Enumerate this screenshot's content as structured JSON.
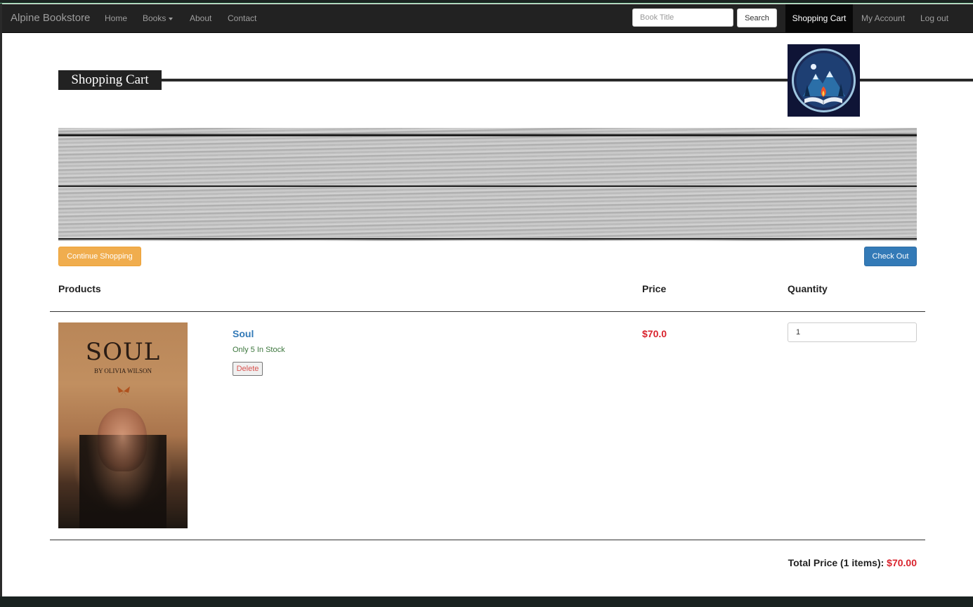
{
  "navbar": {
    "brand": "Alpine Bookstore",
    "links": {
      "home": "Home",
      "books": "Books",
      "about": "About",
      "contact": "Contact"
    },
    "search": {
      "placeholder": "Book Title",
      "button": "Search"
    },
    "cart": "Shopping Cart",
    "account": "My Account",
    "logout": "Log out"
  },
  "page": {
    "title": "Shopping Cart",
    "logo_icon": "mountain-book-campfire-logo"
  },
  "actions": {
    "continue_label": "Continue Shopping",
    "checkout_label": "Check Out"
  },
  "table": {
    "headers": {
      "products": "Products",
      "price": "Price",
      "quantity": "Quantity"
    },
    "items": [
      {
        "name": "Soul",
        "stock_note": "Only 5 In Stock",
        "delete_label": "Delete",
        "price": "$70.0",
        "quantity": "1",
        "cover": {
          "title": "SOUL",
          "author": "BY OLIVIA WILSON"
        }
      }
    ]
  },
  "summary": {
    "label": "Total Price (1 items):",
    "amount": "$70.00"
  },
  "colors": {
    "navbar_bg": "#222222",
    "price_red": "#d9232d",
    "link_blue": "#337ab7",
    "warning_orange": "#f0ad4e",
    "primary_blue": "#337ab7",
    "stock_green": "#3c763d"
  }
}
